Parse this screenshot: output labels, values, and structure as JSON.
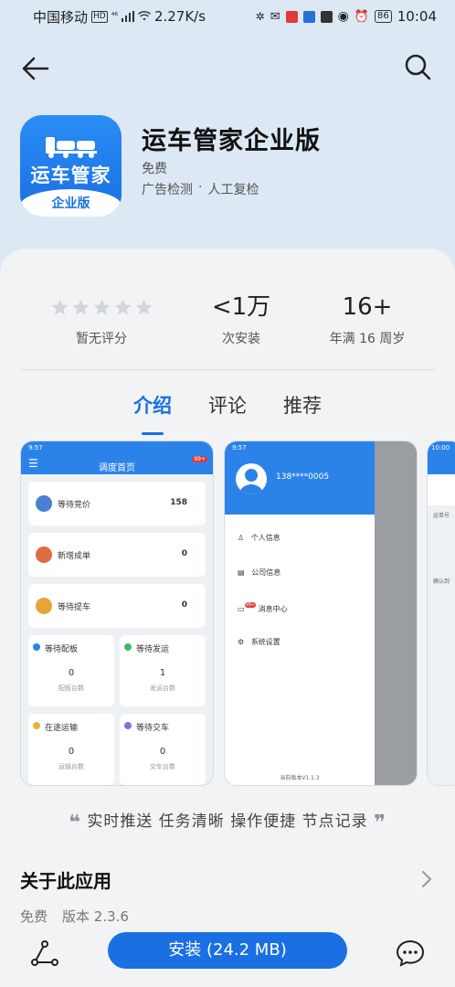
{
  "status_bar": {
    "carrier": "中国移动",
    "hd_badge": "HD",
    "signal": "⁴⁶",
    "net_speed": "2.27K/s",
    "battery": "86",
    "time": "10:04"
  },
  "app": {
    "name": "运车管家企业版",
    "price": "免费",
    "tags": [
      "广告检测",
      "·",
      "人工复检"
    ],
    "icon_title": "运车管家",
    "icon_ribbon": "企业版"
  },
  "stats": {
    "rating_label": "暂无评分",
    "installs_value": "<1万",
    "installs_label": "次安装",
    "age_value": "16+",
    "age_label": "年满 16 周岁"
  },
  "tabs": [
    {
      "label": "介绍",
      "active": true
    },
    {
      "label": "评论",
      "active": false
    },
    {
      "label": "推荐",
      "active": false
    }
  ],
  "screenshot1": {
    "header_title": "调度首页",
    "header_time": "9:57",
    "badge": "99+",
    "cards": [
      {
        "label": "等待竞价",
        "value": "158",
        "color": "#4a7fd6"
      },
      {
        "label": "新增成单",
        "value": "0",
        "color": "#e06a43"
      },
      {
        "label": "等待提车",
        "value": "0",
        "color": "#e6a43a"
      }
    ],
    "small_cards": [
      {
        "label": "等待配板",
        "value": "0",
        "sub": "配板台数",
        "color": "#2b83ea"
      },
      {
        "label": "等待发运",
        "value": "1",
        "sub": "发运台数",
        "color": "#3cba6c"
      },
      {
        "label": "在途运输",
        "value": "0",
        "sub": "运输台数",
        "color": "#e6b13a"
      },
      {
        "label": "等待交车",
        "value": "0",
        "sub": "交车台数",
        "color": "#8a6ee0"
      }
    ]
  },
  "screenshot2": {
    "header_time": "9:57",
    "phone": "138****0005",
    "menu": [
      "个人信息",
      "公司信息",
      "消息中心",
      "系统设置"
    ],
    "badge": "99+",
    "version": "当前版本V1.1.3"
  },
  "screenshot3": {
    "header_time": "10:00",
    "partial_labels": [
      "运单号",
      "确认到"
    ]
  },
  "slogan": {
    "open_quote": "❝",
    "text": "实时推送 任务清晰 操作便捷 节点记录",
    "close_quote": "❞"
  },
  "about": {
    "title": "关于此应用",
    "price": "免费",
    "version": "版本 2.3.6"
  },
  "bottom_bar": {
    "install_label": "安装 (24.2 MB)"
  },
  "colors": {
    "accent": "#1a6fe3",
    "background_top": "#dce8f3",
    "sheet": "#f1f3f5"
  }
}
